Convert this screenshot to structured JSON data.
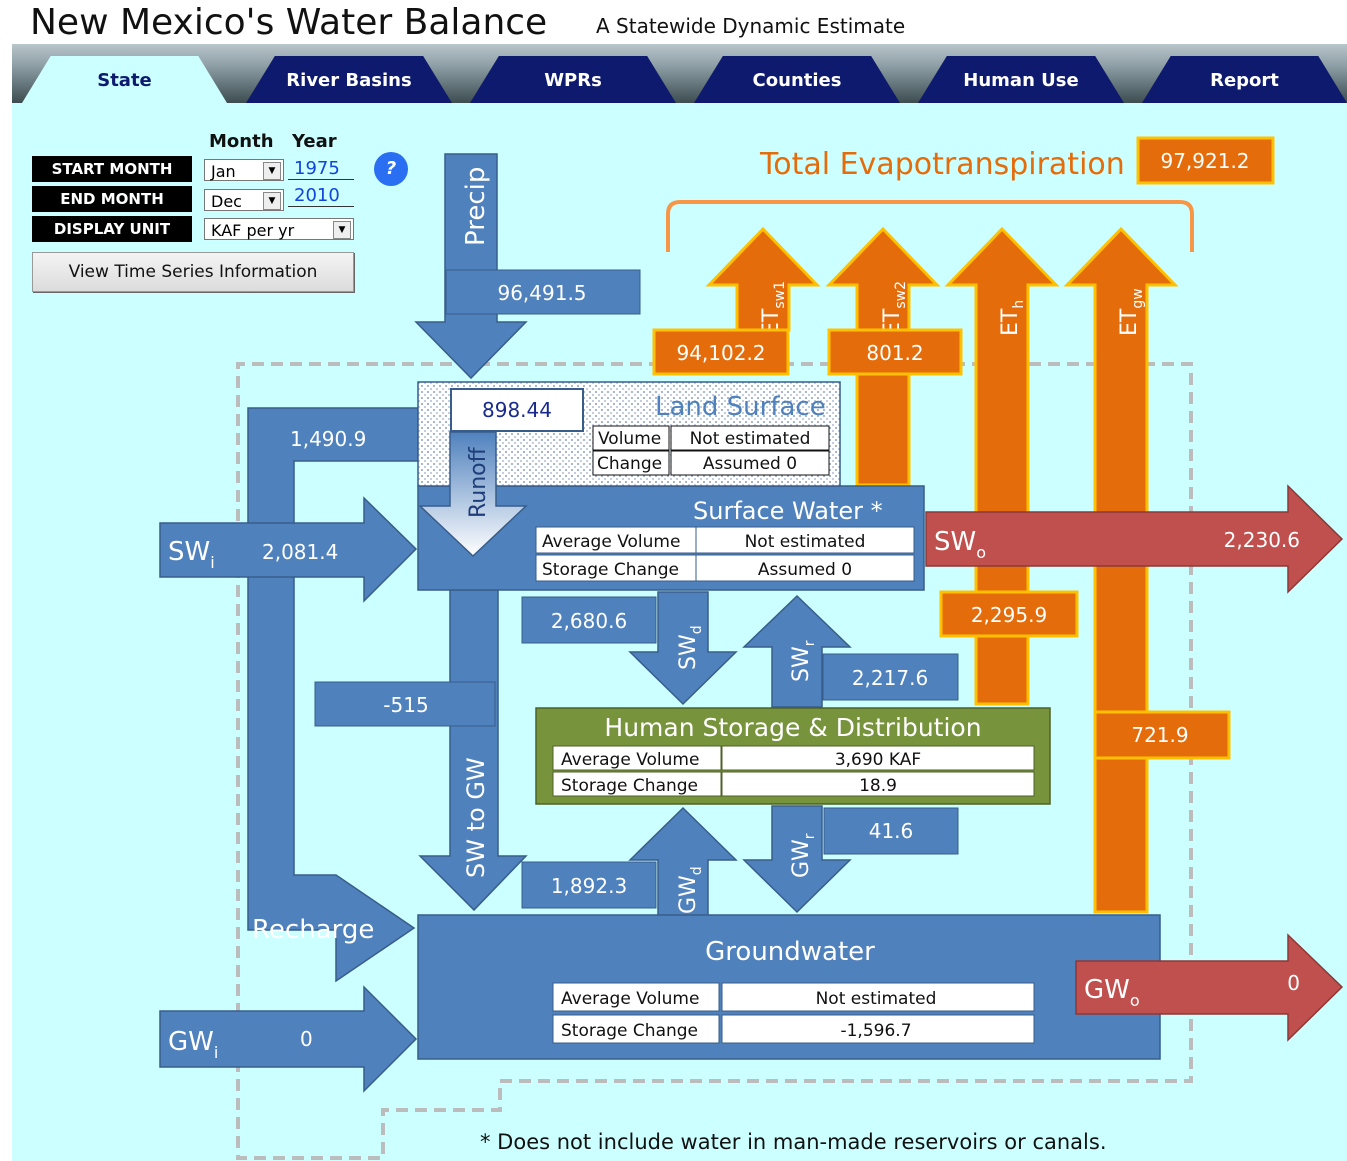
{
  "header": {
    "title": "New Mexico's Water Balance",
    "subtitle": "A Statewide Dynamic Estimate"
  },
  "tabs": [
    {
      "label": "State",
      "active": true
    },
    {
      "label": "River  Basins",
      "active": false
    },
    {
      "label": "WPRs",
      "active": false
    },
    {
      "label": "Counties",
      "active": false
    },
    {
      "label": "Human  Use",
      "active": false
    },
    {
      "label": "Report",
      "active": false
    }
  ],
  "controls": {
    "month_header": "Month",
    "year_header": "Year",
    "start_label": "START MONTH",
    "end_label": "END MONTH",
    "unit_label": "DISPLAY UNIT",
    "start_month": "Jan",
    "start_year": "1975",
    "end_month": "Dec",
    "end_year": "2010",
    "display_unit": "KAF per yr",
    "info_button": "View Time Series Information",
    "help": "?"
  },
  "diagram": {
    "total_et_label": "Total Evapotranspiration",
    "total_et": "97,921.2",
    "precip_label": "Precip",
    "precip": "96,491.5",
    "et_sw1": "94,102.2",
    "et_sw2": "801.2",
    "et_h": "2,295.9",
    "et_gw": "721.9",
    "et_label": "ET",
    "sw1_sub": "sw1",
    "sw2_sub": "sw2",
    "h_sub": "h",
    "gw_sub": "gw",
    "runoff_label": "Runoff",
    "runoff": "898.44",
    "land_surface": {
      "title": "Land Surface",
      "volume_label": "Volume",
      "volume": "Not estimated",
      "change_label": "Change",
      "change": "Assumed 0"
    },
    "surface_water": {
      "title": "Surface Water *",
      "avg_label": "Average Volume",
      "avg": "Not estimated",
      "change_label": "Storage Change",
      "change": "Assumed 0"
    },
    "human": {
      "title": "Human Storage & Distribution",
      "avg_label": "Average Volume",
      "avg": "3,690 KAF",
      "change_label": "Storage Change",
      "change": "18.9"
    },
    "groundwater": {
      "title": "Groundwater",
      "avg_label": "Average Volume",
      "avg": "Not estimated",
      "change_label": "Storage Change",
      "change": "-1,596.7"
    },
    "sw_in_label": "SW",
    "sw_in_sub": "i",
    "sw_in": "2,081.4",
    "sw_out_label": "SW",
    "sw_out_sub": "o",
    "sw_out": "2,230.6",
    "gw_in_label": "GW",
    "gw_in_sub": "i",
    "gw_in": "0",
    "gw_out_label": "GW",
    "gw_out_sub": "o",
    "gw_out": "0",
    "left_flow": "1,490.9",
    "recharge_label": "Recharge",
    "sw_to_gw_label": "SW to GW",
    "sw_to_gw": "-515",
    "swd_label": "SW",
    "swd_sub": "d",
    "swd": "2,680.6",
    "swr_label": "SW",
    "swr_sub": "r",
    "swr": "2,217.6",
    "gwd_label": "GW",
    "gwd_sub": "d",
    "gwd": "1,892.3",
    "gwr_label": "GW",
    "gwr_sub": "r",
    "gwr": "41.6",
    "footnote": "* Does not include water in man-made reservoirs or canals."
  },
  "colors": {
    "background": "#ccffff",
    "blue": "#4f81bd",
    "orange": "#e46c0a",
    "red": "#c0504d",
    "green": "#77933c",
    "tab": "#0e1a6e"
  }
}
